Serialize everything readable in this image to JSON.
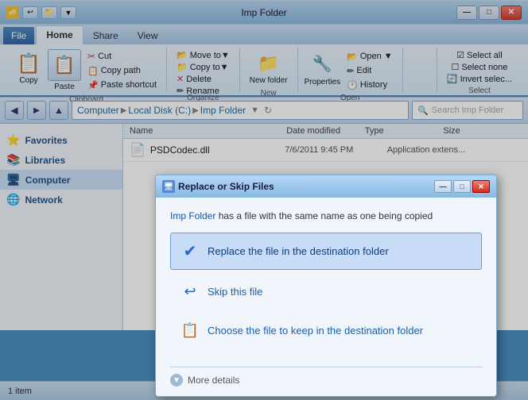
{
  "window": {
    "title": "Imp Folder",
    "icon": "📁"
  },
  "quick_access": {
    "buttons": [
      "↩",
      "📁",
      "▼"
    ]
  },
  "ribbon_tabs": {
    "tabs": [
      "File",
      "Home",
      "Share",
      "View"
    ]
  },
  "ribbon": {
    "clipboard_label": "Clipboard",
    "organize_label": "Organize",
    "new_label": "New",
    "open_label": "Open",
    "select_label": "Select",
    "copy_btn": "Copy",
    "paste_btn": "Paste",
    "cut_label": "Cut",
    "copy_path_label": "Copy path",
    "paste_shortcut_label": "Paste shortcut",
    "move_to_label": "Move to▼",
    "copy_to_label": "Copy to▼",
    "delete_label": "Delete",
    "rename_label": "Rename",
    "new_folder_label": "New folder",
    "properties_label": "Properties",
    "open_label2": "Open ▼",
    "edit_label": "Edit",
    "history_label": "History",
    "select_all_label": "Select all",
    "select_none_label": "Select none",
    "invert_select_label": "Invert selec..."
  },
  "address_bar": {
    "back_btn": "◀",
    "forward_btn": "▶",
    "up_btn": "▲",
    "breadcrumb": [
      "Computer",
      "Local Disk (C:)",
      "Imp Folder"
    ],
    "search_placeholder": "Search Imp Folder"
  },
  "sidebar": {
    "items": [
      {
        "label": "Favorites",
        "icon": "⭐"
      },
      {
        "label": "Libraries",
        "icon": "📚"
      },
      {
        "label": "Computer",
        "icon": "🖥"
      },
      {
        "label": "Network",
        "icon": "🌐"
      }
    ]
  },
  "file_list": {
    "headers": [
      "Name",
      "Date modified",
      "Type",
      "Size"
    ],
    "files": [
      {
        "icon": "📄",
        "name": "PSDCodec.dll",
        "date": "7/6/2011 9:45 PM",
        "type": "Application extens...",
        "size": ""
      }
    ]
  },
  "status_bar": {
    "text": "1 item"
  },
  "dialog": {
    "title": "Replace or Skip Files",
    "subtitle_text": " has a file with the same name as one being copied",
    "subtitle_link": "Imp Folder",
    "option1": "Replace the file in the destination folder",
    "option1_icon": "✔",
    "option2": "Skip this file",
    "option2_icon": "↩",
    "option3": "Choose the file to keep in the destination folder",
    "option3_icon": "📋",
    "more_details": "More details",
    "controls": {
      "minimize": "—",
      "maximize": "□",
      "close": "✕"
    }
  }
}
